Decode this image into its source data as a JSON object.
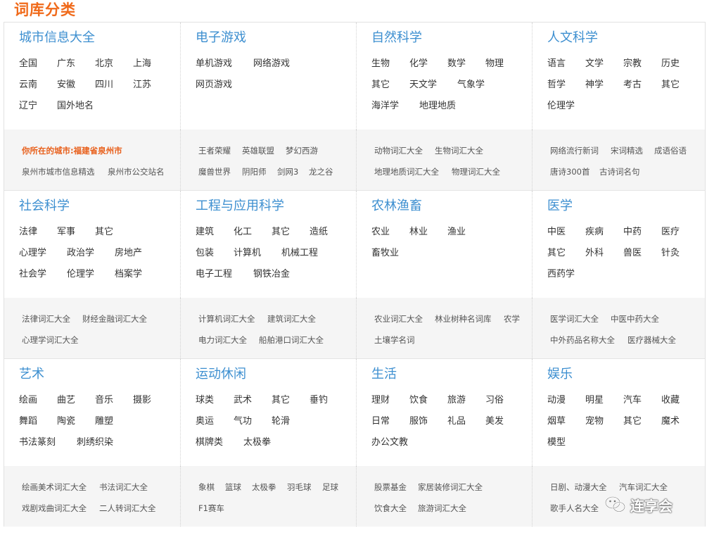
{
  "page": {
    "title": "词库分类"
  },
  "rows": [
    {
      "categories": [
        {
          "title": "城市信息大全",
          "words": [
            [
              "全国",
              "广东",
              "北京",
              "上海"
            ],
            [
              "云南",
              "安徽",
              "四川",
              "江苏"
            ],
            [
              "辽宁",
              "国外地名"
            ]
          ],
          "links_note": "你所在的城市:福建省泉州市",
          "links": [
            [
              "泉州市城市信息精选",
              "泉州市公交站名"
            ]
          ]
        },
        {
          "title": "电子游戏",
          "words": [
            [
              "单机游戏",
              "网络游戏"
            ],
            [
              "网页游戏"
            ]
          ],
          "links": [
            [
              "王者荣耀",
              "英雄联盟",
              "梦幻西游"
            ],
            [
              "魔兽世界",
              "阴阳师",
              "剑网3",
              "龙之谷"
            ]
          ]
        },
        {
          "title": "自然科学",
          "words": [
            [
              "生物",
              "化学",
              "数学",
              "物理"
            ],
            [
              "其它",
              "天文学",
              "气象学"
            ],
            [
              "海洋学",
              "地理地质"
            ]
          ],
          "links": [
            [
              "动物词汇大全",
              "生物词汇大全"
            ],
            [
              "地理地质词汇大全",
              "物理词汇大全"
            ]
          ]
        },
        {
          "title": "人文科学",
          "words": [
            [
              "语言",
              "文学",
              "宗教",
              "历史"
            ],
            [
              "哲学",
              "神学",
              "考古",
              "其它"
            ],
            [
              "伦理学"
            ]
          ],
          "links": [
            [
              "网络流行新词",
              "宋词精选",
              "成语俗语"
            ],
            [
              "唐诗300首",
              "古诗词名句"
            ]
          ]
        }
      ]
    },
    {
      "categories": [
        {
          "title": "社会科学",
          "words": [
            [
              "法律",
              "军事",
              "其它"
            ],
            [
              "心理学",
              "政治学",
              "房地产"
            ],
            [
              "社会学",
              "伦理学",
              "档案学"
            ]
          ],
          "links": [
            [
              "法律词汇大全",
              "财经金融词汇大全"
            ],
            [
              "心理学词汇大全"
            ]
          ]
        },
        {
          "title": "工程与应用科学",
          "words": [
            [
              "建筑",
              "化工",
              "其它",
              "造纸"
            ],
            [
              "包装",
              "计算机",
              "机械工程"
            ],
            [
              "电子工程",
              "钢铁冶金"
            ]
          ],
          "links": [
            [
              "计算机词汇大全",
              "建筑词汇大全"
            ],
            [
              "电力词汇大全",
              "船舶港口词汇大全"
            ]
          ]
        },
        {
          "title": "农林渔畜",
          "words": [
            [
              "农业",
              "林业",
              "渔业"
            ],
            [
              "畜牧业"
            ]
          ],
          "links": [
            [
              "农业词汇大全",
              "林业树种名词库",
              "农学"
            ],
            [
              "土壤学名词"
            ]
          ]
        },
        {
          "title": "医学",
          "words": [
            [
              "中医",
              "疾病",
              "中药",
              "医疗"
            ],
            [
              "其它",
              "外科",
              "兽医",
              "针灸"
            ],
            [
              "西药学"
            ]
          ],
          "links": [
            [
              "医学词汇大全",
              "中医中药大全"
            ],
            [
              "中外药品名称大全",
              "医疗器械大全"
            ]
          ]
        }
      ]
    },
    {
      "categories": [
        {
          "title": "艺术",
          "words": [
            [
              "绘画",
              "曲艺",
              "音乐",
              "摄影"
            ],
            [
              "舞蹈",
              "陶瓷",
              "雕塑"
            ],
            [
              "书法篆刻",
              "刺绣织染"
            ]
          ],
          "links": [
            [
              "绘画美术词汇大全",
              "书法词汇大全"
            ],
            [
              "戏剧戏曲词汇大全",
              "二人转词汇大全"
            ]
          ]
        },
        {
          "title": "运动休闲",
          "words": [
            [
              "球类",
              "武术",
              "其它",
              "垂钓"
            ],
            [
              "奥运",
              "气功",
              "轮滑"
            ],
            [
              "棋牌类",
              "太极拳"
            ]
          ],
          "links": [
            [
              "象棋",
              "篮球",
              "太极拳",
              "羽毛球",
              "足球"
            ],
            [
              "F1赛车"
            ]
          ]
        },
        {
          "title": "生活",
          "words": [
            [
              "理财",
              "饮食",
              "旅游",
              "习俗"
            ],
            [
              "日常",
              "服饰",
              "礼品",
              "美发"
            ],
            [
              "办公文教"
            ]
          ],
          "links": [
            [
              "股票基金",
              "家居装修词汇大全"
            ],
            [
              "饮食大全",
              "旅游词汇大全"
            ]
          ]
        },
        {
          "title": "娱乐",
          "words": [
            [
              "动漫",
              "明星",
              "汽车",
              "收藏"
            ],
            [
              "烟草",
              "宠物",
              "其它",
              "魔术"
            ],
            [
              "模型"
            ]
          ],
          "links": [
            [
              "日剧、动漫大全",
              "汽车词汇大全"
            ],
            [
              "歌手人名大全"
            ]
          ]
        }
      ]
    }
  ],
  "watermark": {
    "text": "连享会",
    "icon": "wechat-icon"
  },
  "colors": {
    "title": "#f06a1a",
    "category": "#3d8fd0",
    "note": "#e8601c",
    "panel": "#f5f5f5",
    "border": "#e2e2e2"
  }
}
